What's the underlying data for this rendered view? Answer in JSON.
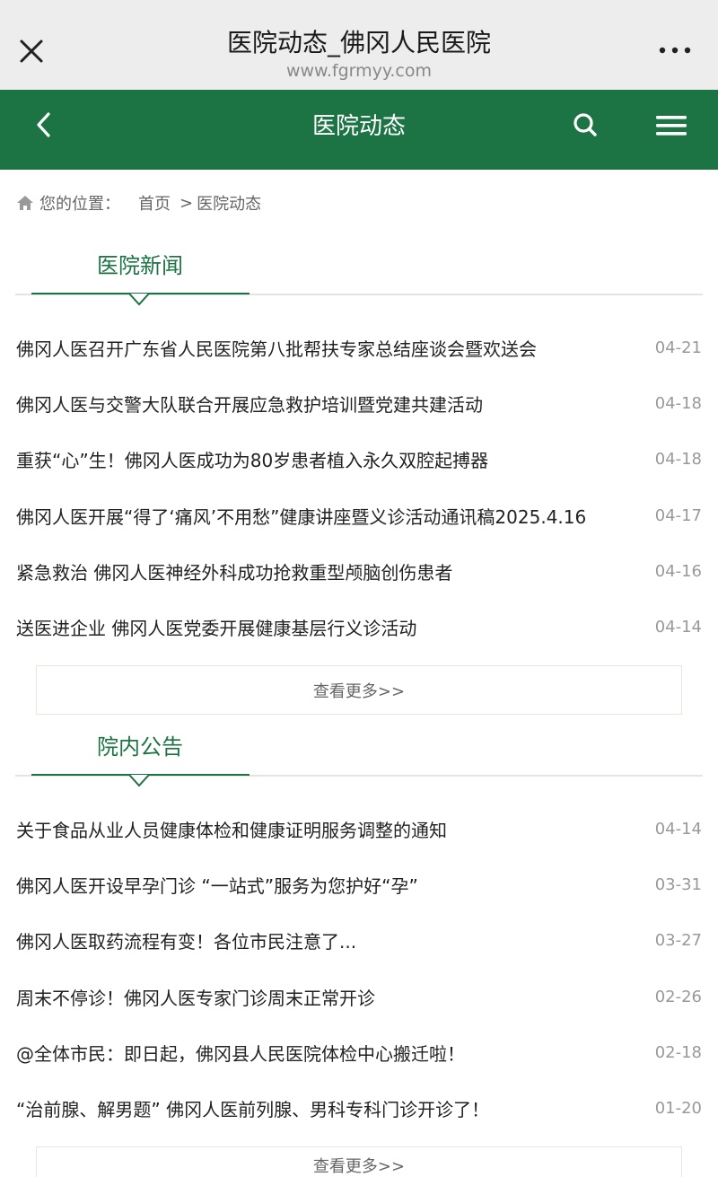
{
  "topbar": {
    "title": "医院动态_佛冈人民医院",
    "url": "www.fgrmyy.com"
  },
  "header": {
    "title": "医院动态"
  },
  "breadcrumb": {
    "label": "您的位置：",
    "home": "首页",
    "sep": ">",
    "current": "医院动态"
  },
  "news": {
    "title": "医院新闻",
    "items": [
      {
        "title": "佛冈人医召开广东省人民医院第八批帮扶专家总结座谈会暨欢送会",
        "date": "04-21"
      },
      {
        "title": "佛冈人医与交警大队联合开展应急救护培训暨党建共建活动",
        "date": "04-18"
      },
      {
        "title": "重获“心”生！佛冈人医成功为80岁患者植入永久双腔起搏器",
        "date": "04-18"
      },
      {
        "title": "佛冈人医开展“得了‘痛风’不用愁”健康讲座暨义诊活动通讯稿2025.4.16",
        "date": "04-17"
      },
      {
        "title": "紧急救治 佛冈人医神经外科成功抢救重型颅脑创伤患者",
        "date": "04-16"
      },
      {
        "title": "送医进企业 佛冈人医党委开展健康基层行义诊活动",
        "date": "04-14"
      }
    ],
    "more": "查看更多>>"
  },
  "notice": {
    "title": "院内公告",
    "items": [
      {
        "title": "关于食品从业人员健康体检和健康证明服务调整的通知",
        "date": "04-14"
      },
      {
        "title": "佛冈人医开设早孕门诊 “一站式”服务为您护好“孕”",
        "date": "03-31"
      },
      {
        "title": "佛冈人医取药流程有变！各位市民注意了...",
        "date": "03-27"
      },
      {
        "title": "周末不停诊！佛冈人医专家门诊周末正常开诊",
        "date": "02-26"
      },
      {
        "title": "@全体市民：即日起，佛冈县人民医院体检中心搬迁啦！",
        "date": "02-18"
      },
      {
        "title": "“治前腺、解男题” 佛冈人医前列腺、男科专科门诊开诊了！",
        "date": "01-20"
      }
    ],
    "more": "查看更多>>"
  },
  "colors": {
    "brand_green": "#1c7343",
    "topbar_bg": "#ededed"
  },
  "icons": {
    "close": "close-icon",
    "more": "more-dots-icon",
    "back": "chevron-left-icon",
    "search": "search-icon",
    "menu": "hamburger-menu-icon",
    "home": "home-icon"
  }
}
